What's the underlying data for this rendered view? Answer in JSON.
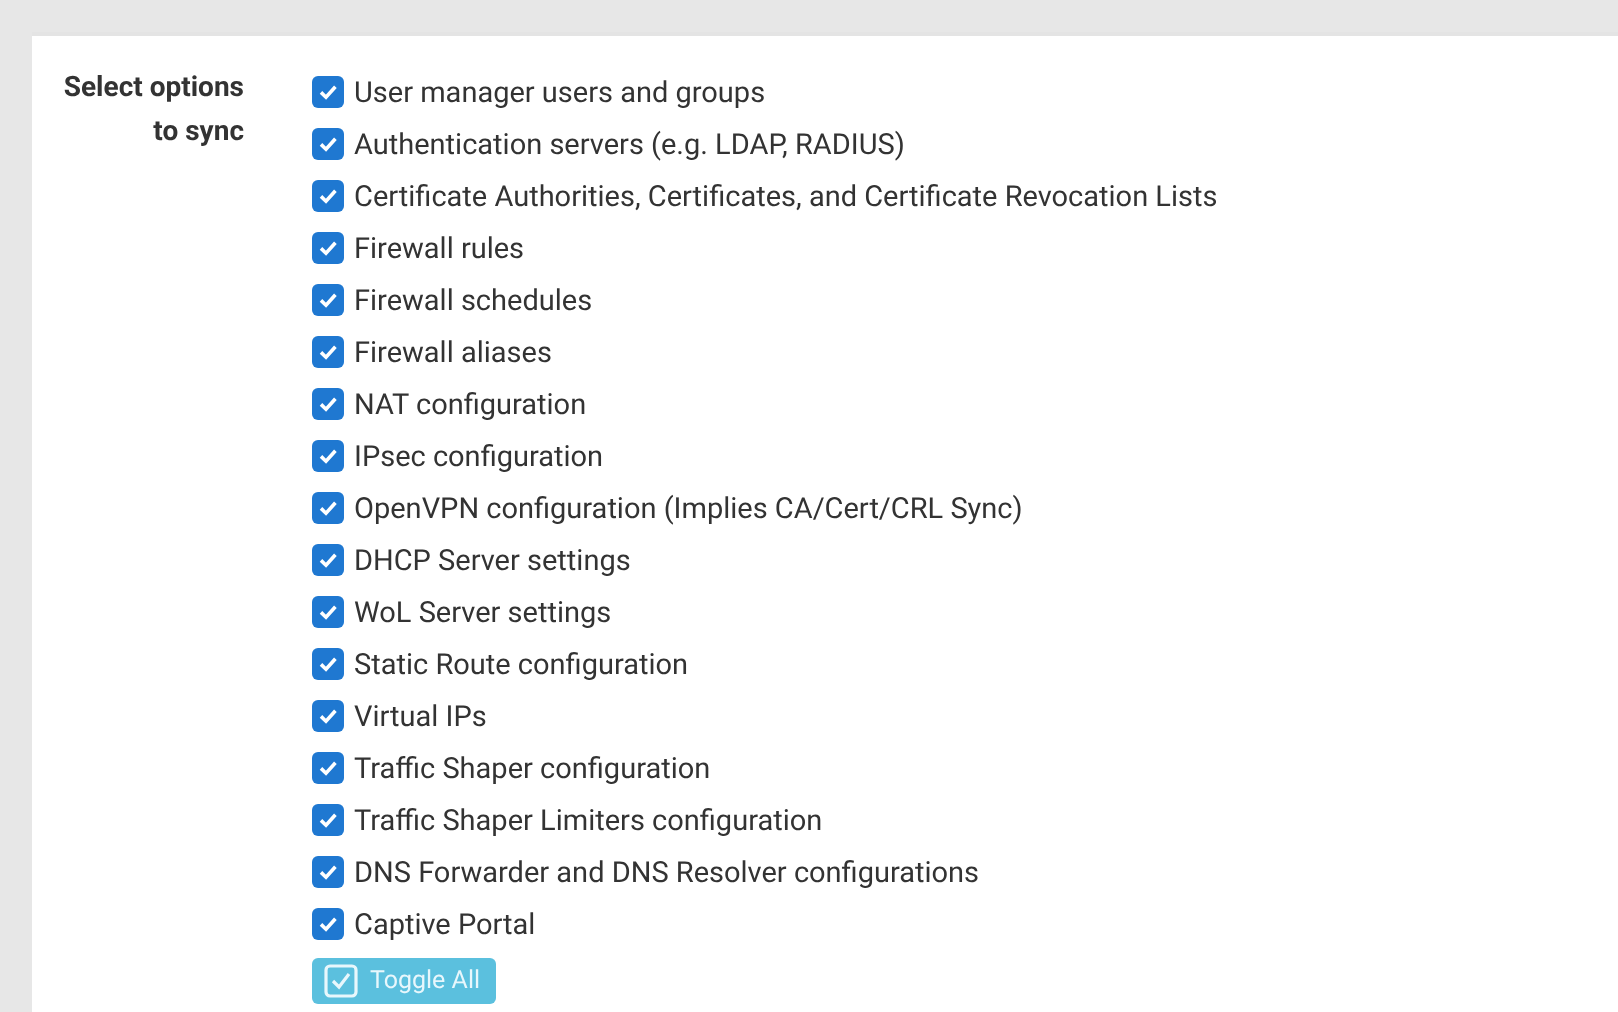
{
  "field_label": "Select options to sync",
  "options": [
    {
      "label": "User manager users and groups",
      "checked": true
    },
    {
      "label": "Authentication servers (e.g. LDAP, RADIUS)",
      "checked": true
    },
    {
      "label": "Certificate Authorities, Certificates, and Certificate Revocation Lists",
      "checked": true
    },
    {
      "label": "Firewall rules",
      "checked": true
    },
    {
      "label": "Firewall schedules",
      "checked": true
    },
    {
      "label": "Firewall aliases",
      "checked": true
    },
    {
      "label": "NAT configuration",
      "checked": true
    },
    {
      "label": "IPsec configuration",
      "checked": true
    },
    {
      "label": "OpenVPN configuration (Implies CA/Cert/CRL Sync)",
      "checked": true
    },
    {
      "label": "DHCP Server settings",
      "checked": true
    },
    {
      "label": "WoL Server settings",
      "checked": true
    },
    {
      "label": "Static Route configuration",
      "checked": true
    },
    {
      "label": "Virtual IPs",
      "checked": true
    },
    {
      "label": "Traffic Shaper configuration",
      "checked": true
    },
    {
      "label": "Traffic Shaper Limiters configuration",
      "checked": true
    },
    {
      "label": "DNS Forwarder and DNS Resolver configurations",
      "checked": true
    },
    {
      "label": "Captive Portal",
      "checked": true
    }
  ],
  "toggle_button": "Toggle All"
}
